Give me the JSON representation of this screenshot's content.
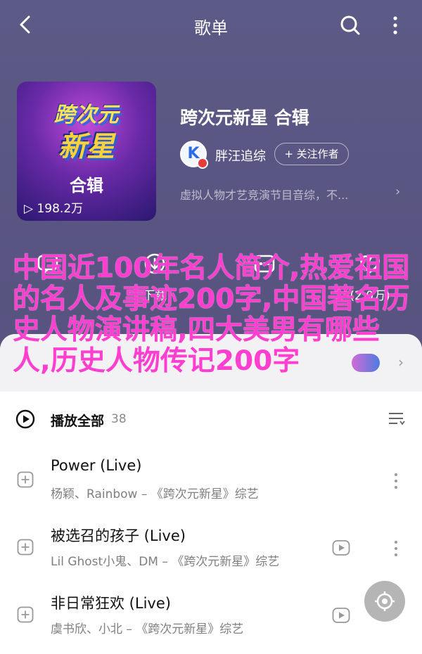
{
  "header": {
    "title": "歌单"
  },
  "playlist": {
    "cover": {
      "logo_line1": "跨次元",
      "logo_line2": "新星",
      "subtitle": "合辑",
      "plays": "198.2万"
    },
    "title": "跨次元新星 合辑",
    "creator": {
      "name": "胖汪追综",
      "avatar_letter": "K"
    },
    "follow_label": "+ 关注作者",
    "description": "虚拟人物才艺竞演节目音综，不..."
  },
  "actions": [
    {
      "label": ""
    },
    {
      "label": "下载"
    },
    {
      "label": ""
    },
    {
      "label": "(2.0万)"
    }
  ],
  "overlay_text": "中国近100年名人简介,热爱祖国的名人及事迹200字,中国著名历史人物演讲稿,四大美男有哪些人,历史人物传记200字",
  "list": {
    "play_all_label": "播放全部",
    "count": "38",
    "songs": [
      {
        "name": "Power (Live)",
        "meta": "杨颖、Rainbow – 《跨次元新星》综艺"
      },
      {
        "name": "被选召的孩子 (Live)",
        "meta": "Lil Ghost小鬼、DM – 《跨次元新星》综艺"
      },
      {
        "name": "非日常狂欢 (Live)",
        "meta": "虞书欣、小北 – 《跨次元新星》综艺"
      }
    ]
  },
  "colors": {
    "hero_bg": "#5a5683",
    "overlay_text": "#ff3fd0",
    "accent_badge": "#e53b3b"
  }
}
